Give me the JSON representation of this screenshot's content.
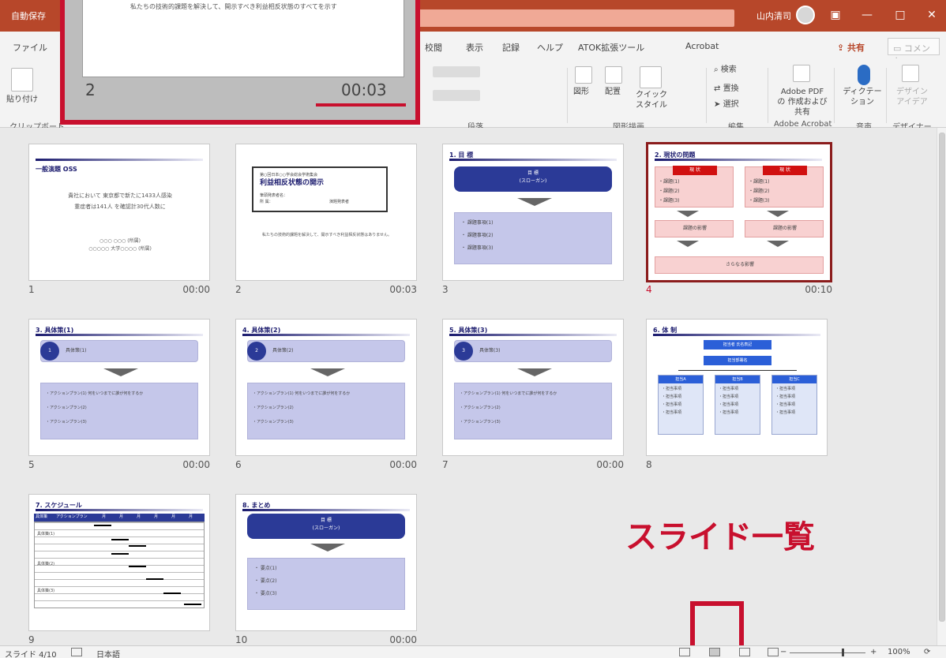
{
  "titlebar": {
    "autosave": "自動保存",
    "user": "山内清司",
    "min": "—",
    "restore": "□",
    "close": "✕",
    "ribbon_toggle": "▣"
  },
  "menu": {
    "file": "ファイル",
    "review": "校閲",
    "view": "表示",
    "record": "記録",
    "help": "ヘルプ",
    "atok": "ATOK拡張ツール",
    "acrobat": "Acrobat",
    "share": "共有",
    "comment": "コメント"
  },
  "ribbon": {
    "clipboard": "クリップボード",
    "paste": "貼り付け",
    "paragraph": "段落",
    "drawing": "図形描画",
    "arrange": "配置",
    "quick_style": "クイック スタイル",
    "shape": "図形",
    "find": "検索",
    "replace": "置換",
    "select": "選択",
    "editing": "編集",
    "adobe_pdf": "Adobe PDF の 作成および共有",
    "adobe_acrobat": "Adobe Acrobat",
    "dictation": "ディクテー ション",
    "voice": "音声",
    "design_idea": "デザイン アイデア",
    "designer": "デザイナー"
  },
  "popup": {
    "slide_num": "2",
    "time": "00:03",
    "text": "私たちの技術的課題を解決して、開示すべき利益相反状態のすべてを示す"
  },
  "slides": [
    {
      "num": "1",
      "time": "00:00",
      "header": "一般演題 OSS",
      "line1": "貴社において 東京都で新たに1433人感染",
      "line2": "重症者は141人 を確認計30代人数に",
      "line3": "○○○ ○○○ (所属)",
      "line4": "○○○○○ 大学○○○○ (所属)"
    },
    {
      "num": "2",
      "time": "00:03",
      "box_sub": "第○回日本○○学会総会学術集会",
      "box_title": "利益相反状態の開示",
      "box_name": "筆頭発表者名：",
      "box_person": "所  属：",
      "box_footer": "演題発表者",
      "body": "私たちの技術的課題を解決して、開示すべき利益相反状態はありません。"
    },
    {
      "num": "3",
      "time": "",
      "header": "1. 目 標",
      "box": "目 標",
      "box_sub": "(スローガン)",
      "items": [
        "・ 課題事項(1)",
        "・ 課題事項(2)",
        "・ 課題事項(3)"
      ]
    },
    {
      "num": "4",
      "time": "00:10",
      "header": "2. 現状の問題",
      "red": "現 状",
      "left": [
        "・課題(1)",
        "・課題(2)",
        "・課題(3)"
      ],
      "right": [
        "・課題(1)",
        "・課題(2)",
        "・課題(3)"
      ],
      "cause": "課題の影響",
      "result": "さらなる影響"
    },
    {
      "num": "5",
      "time": "00:00",
      "header": "3. 具体策(1)",
      "badge": "1",
      "title": "具体策(1)",
      "items": [
        "・アクションプラン(1)  何をいつまでに誰が何をするか",
        "・アクションプラン(2)",
        "・アクションプラン(3)"
      ]
    },
    {
      "num": "6",
      "time": "00:00",
      "header": "4. 具体策(2)",
      "badge": "2",
      "title": "具体策(2)",
      "items": [
        "・アクションプラン(1)  何をいつまでに誰が何をするか",
        "・アクションプラン(2)",
        "・アクションプラン(3)"
      ]
    },
    {
      "num": "7",
      "time": "00:00",
      "header": "5. 具体策(3)",
      "badge": "3",
      "title": "具体策(3)",
      "items": [
        "・アクションプラン(1)  何をいつまでに誰が何をするか",
        "・アクションプラン(2)",
        "・アクションプラン(3)"
      ]
    },
    {
      "num": "8",
      "time": "",
      "header": "6. 体 制",
      "top": "担当者 氏名表記",
      "mid": "担当部署名",
      "cols": [
        "担当A",
        "担当B",
        "担当C"
      ],
      "rows": [
        "・担当事項",
        "・担当事項",
        "・担当事項",
        "・担当事項"
      ]
    },
    {
      "num": "9",
      "time": "",
      "header": "7. スケジュール",
      "col1": "具体策",
      "col2": "アクションプラン",
      "months": [
        "月",
        "月",
        "月",
        "月",
        "月",
        "月"
      ],
      "groups": [
        "具体策(1)",
        "具体策(2)",
        "具体策(3)"
      ],
      "plan": "アクションプラン"
    },
    {
      "num": "10",
      "time": "00:00",
      "header": "8. まとめ",
      "box": "目 標",
      "box_sub": "(スローガン)",
      "items": [
        "・ 要点(1)",
        "・ 要点(2)",
        "・ 要点(3)"
      ]
    }
  ],
  "annotation": "スライド一覧",
  "status": {
    "slide": "スライド 4/10",
    "lang": "日本語",
    "zoom": "100%",
    "zoom_minus": "−",
    "zoom_plus": "+"
  }
}
